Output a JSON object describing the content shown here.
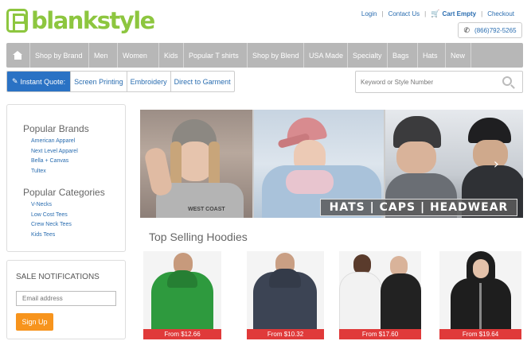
{
  "brand": {
    "logo_text": "blankstyle",
    "color": "#8dc63f"
  },
  "top_links": {
    "login": "Login",
    "contact": "Contact Us",
    "cart": "Cart Empty",
    "checkout": "Checkout",
    "separator": "|"
  },
  "phone": "(866)792-5265",
  "nav": {
    "items": [
      "Shop by Brand",
      "Men",
      "Women",
      "Kids",
      "Popular T shirts",
      "Shop by Blend",
      "USA Made",
      "Specialty",
      "Bags",
      "Hats",
      "New"
    ]
  },
  "quote": {
    "instant": "Instant Quote:",
    "links": [
      "Screen Printing",
      "Embroidery",
      "Direct to Garment"
    ]
  },
  "search": {
    "placeholder": "Keyword or Style Number"
  },
  "sidebar": {
    "popular_brands": {
      "title": "Popular Brands",
      "items": [
        "American Apparel",
        "Next Level Apparel",
        "Bella + Canvas",
        "Tultex"
      ]
    },
    "popular_categories": {
      "title": "Popular Categories",
      "items": [
        "V-Necks",
        "Low Cost Tees",
        "Crew Neck Tees",
        "Kids Tees"
      ]
    }
  },
  "sale": {
    "title": "SALE NOTIFICATIONS",
    "email_placeholder": "Email address",
    "signup": "Sign Up"
  },
  "banner": {
    "caption": "HATS | CAPS | HEADWEAR",
    "next_arrow": "›",
    "sweatshirt_text": "WEST COAST"
  },
  "top_selling": {
    "title": "Top Selling Hoodies",
    "products": [
      {
        "price": "From   $12.66",
        "color": "#2e9a3e"
      },
      {
        "price": "From   $10.32",
        "color": "#3c4454"
      },
      {
        "price": "From   $17.60",
        "color": "#222222"
      },
      {
        "price": "From   $19.64",
        "color": "#1e1e1e"
      }
    ]
  },
  "colors": {
    "link": "#2a6db0",
    "nav_bg": "#b7b7b7",
    "quote_btn": "#2a72c4",
    "signup": "#f7941d",
    "price_tag": "#e03a3a"
  }
}
